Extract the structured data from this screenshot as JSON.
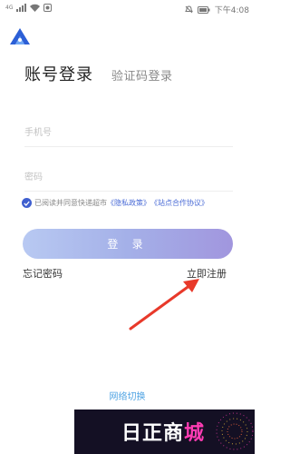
{
  "status_bar": {
    "time": "下午4:08",
    "battery": "▮",
    "network": "4G"
  },
  "tabs": {
    "account_login": "账号登录",
    "code_login": "验证码登录"
  },
  "form": {
    "phone_placeholder": "手机号",
    "password_placeholder": "密码"
  },
  "agreement": {
    "prefix": "已阅读并同意快递超市",
    "privacy_link": "《隐私政策》",
    "partner_link": "《站点合作协议》",
    "checked": true
  },
  "login_button": "登 录",
  "forgot_password": "忘记密码",
  "register": "立即注册",
  "network_switch": "网络切换",
  "watermark": {
    "text_main": "日正商",
    "text_accent": "城"
  },
  "colors": {
    "accent": "#3f5fcf",
    "link": "#4a6bd6",
    "network_link": "#4fa3e3",
    "arrow": "#e8392a"
  }
}
